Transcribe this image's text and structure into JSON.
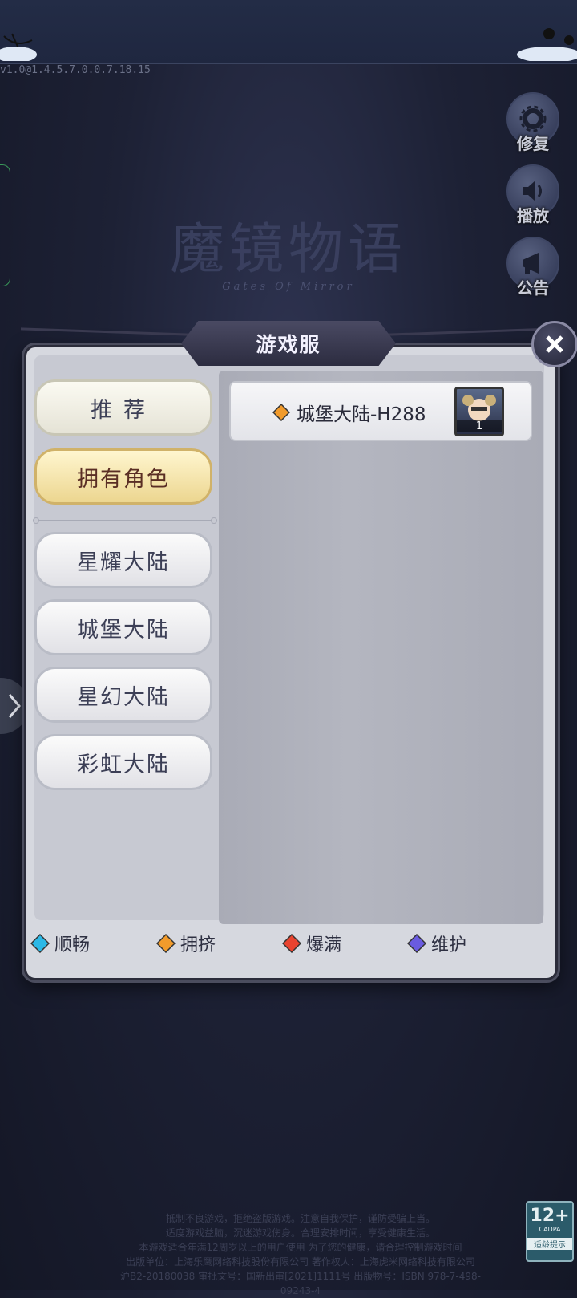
{
  "version": "v1.0@1.4.5.7.0.0.7.18.15",
  "logo": {
    "title": "魔镜物语",
    "subtitle": "Gates Of Mirror"
  },
  "side_buttons": [
    {
      "label": "修复",
      "icon": "gear-icon"
    },
    {
      "label": "播放",
      "icon": "speaker-icon"
    },
    {
      "label": "公告",
      "icon": "megaphone-icon"
    }
  ],
  "dialog": {
    "title": "游戏服",
    "close_icon": "close-icon",
    "categories": [
      {
        "label": "推荐",
        "selected": false
      },
      {
        "label": "拥有角色",
        "selected": true
      },
      {
        "label": "星耀大陆",
        "selected": false
      },
      {
        "label": "城堡大陆",
        "selected": false
      },
      {
        "label": "星幻大陆",
        "selected": false
      },
      {
        "label": "彩虹大陆",
        "selected": false
      }
    ],
    "servers": [
      {
        "name": "城堡大陆-H288",
        "status": "拥挤",
        "status_color": "#f29b2b",
        "character_level": "1"
      }
    ],
    "legend": [
      {
        "label": "顺畅",
        "color": "#2bb8e6"
      },
      {
        "label": "拥挤",
        "color": "#f29b2b"
      },
      {
        "label": "爆满",
        "color": "#e8432f"
      },
      {
        "label": "维护",
        "color": "#6a5be0"
      }
    ]
  },
  "footer": {
    "lines": [
      "抵制不良游戏，拒绝盗版游戏。注意自我保护，谨防受骗上当。",
      "适度游戏益脑，沉迷游戏伤身。合理安排时间，享受健康生活。",
      "本游戏适合年满12周岁以上的用户使用 为了您的健康，请合理控制游戏时间",
      "出版单位：上海乐鹰网络科技股份有限公司 著作权人：上海虎米网络科技有限公司",
      "沪B2-20180038 审批文号：国新出审[2021]1111号 出版物号：ISBN 978-7-498-09243-4"
    ],
    "age_rating": "12+",
    "age_org": "CADPA",
    "age_tip": "适龄提示"
  }
}
